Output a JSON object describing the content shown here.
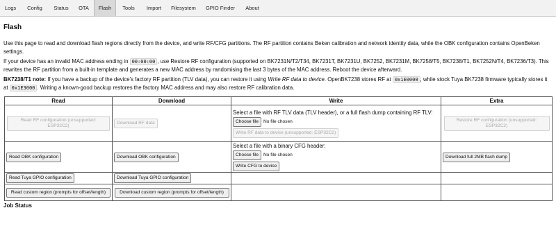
{
  "tabs": [
    {
      "label": "Logs",
      "active": false
    },
    {
      "label": "Config",
      "active": false
    },
    {
      "label": "Status",
      "active": false
    },
    {
      "label": "OTA",
      "active": false
    },
    {
      "label": "Flash",
      "active": true
    },
    {
      "label": "Tools",
      "active": false
    },
    {
      "label": "Import",
      "active": false
    },
    {
      "label": "Filesystem",
      "active": false
    },
    {
      "label": "GPIO Finder",
      "active": false
    },
    {
      "label": "About",
      "active": false
    }
  ],
  "page_title": "Flash",
  "intro": "Use this page to read and download flash regions directly from the device, and write RF/CFG partitions. The RF partition contains Beken calibration and network identity data, while the OBK configuration contains OpenBeken settings.",
  "mac_note": {
    "before": "If your device has an invalid MAC address ending in ",
    "code": "00:00:00",
    "after": ", use Restore RF configuration (supported on BK7231N/T2/T34, BK7231T, BK7231U, BK7252, BK7231M, BK7258/T5, BK7238/T1, BK7252N/T4, BK7236/T3). This rewrites the RF partition from a built-in template and generates a new MAC address by randomising the last 3 bytes of the MAC address. Reboot the device afterward."
  },
  "bk7238_note": {
    "label": "BK7238/T1 note:",
    "part1": " If you have a backup of the device's factory RF partition (TLV data), you can restore it using ",
    "italic": "Write RF data to device",
    "part2": ". OpenBK7238 stores RF at ",
    "code1": "0x1E0000",
    "part3": ", while stock Tuya BK7238 firmware typically stores it at ",
    "code2": "0x1E3000",
    "part4": ". Writing a known-good backup restores the factory MAC address and may also restore RF calibration data."
  },
  "table": {
    "headers": {
      "read": "Read",
      "download": "Download",
      "write": "Write",
      "extra": "Extra"
    },
    "row1": {
      "read_btn": "Read RF configuration (unsupported: ESP32C2)",
      "download_btn": "Download RF data",
      "write_text": "Select a file with RF TLV data (TLV header), or a full flash dump containing RF TLV:",
      "choose_file": "Choose file",
      "no_file": "No file chosen",
      "write_btn": "Write RF data to device (unsupported: ESP32C2)",
      "extra_btn": "Restore RF configuration (unsupported: ESP32C2)"
    },
    "row2": {
      "read_btn": "Read OBK configuration",
      "download_btn": "Download OBK configuration",
      "write_text": "Select a file with a binary CFG header:",
      "choose_file": "Choose file",
      "no_file": "No file chosen",
      "write_btn": "Write CFG to device",
      "extra_btn": "Download full 2MB flash dump"
    },
    "row3": {
      "read_btn": "Read Tuya GPIO configuration",
      "download_btn": "Download Tuya GPIO configuration"
    },
    "row4": {
      "read_btn": "Read custom region (prompts for offset/length)",
      "download_btn": "Download custom region (prompts for offset/length)"
    }
  },
  "job_status": "Job Status"
}
